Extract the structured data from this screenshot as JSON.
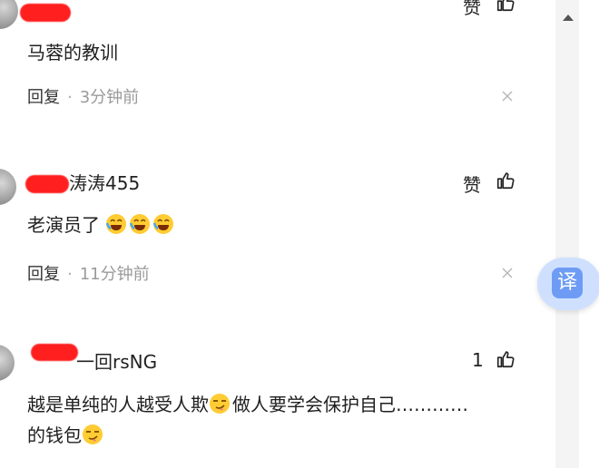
{
  "comments": [
    {
      "username": "",
      "like_label": "赞",
      "text": "马蓉的教训",
      "reply_label": "回复",
      "time": "3分钟前"
    },
    {
      "username": "涛涛455",
      "like_label": "赞",
      "text": "老演员了",
      "text_emojis": [
        "crying-laughing-emoji",
        "crying-laughing-emoji",
        "crying-laughing-emoji"
      ],
      "reply_label": "回复",
      "time": "11分钟前"
    },
    {
      "username": "一回rsNG",
      "like_label": "1",
      "text_line1": "越是单纯的人越受人欺",
      "text_line1_after": "做人要学会保护自己…………",
      "text_line2": "的钱包",
      "text_emojis": [
        "smirk-tongue-emoji",
        "smirk-tongue-emoji"
      ]
    }
  ],
  "translate_button": {
    "label": "译"
  },
  "colors": {
    "redaction": "#ff1f1f",
    "meta_time": "#9a9a9a",
    "translate_bg": "#cfe0ff",
    "translate_icon": "#6e9cf5"
  }
}
